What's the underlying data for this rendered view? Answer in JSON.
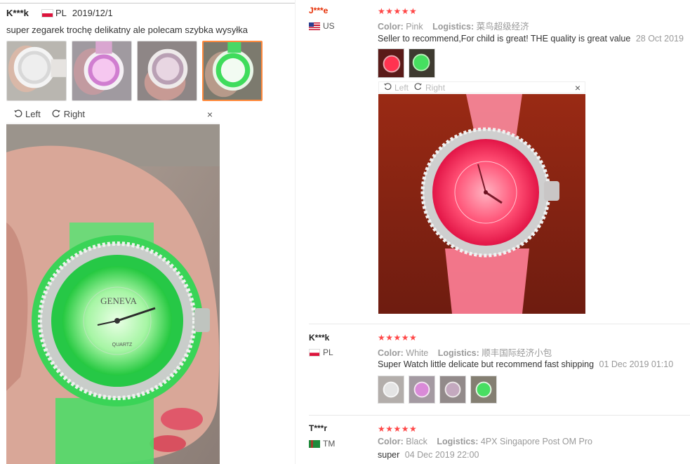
{
  "left_review": {
    "user": "K***k",
    "country": "PL",
    "date": "2019/12/1",
    "text": "super zegarek trochę delikatny ale polecam szybka wysyłka",
    "viewer": {
      "left_label": "Left",
      "right_label": "Right",
      "close": "×"
    },
    "photo_logo": "GENEVA",
    "photo_sub": "QUARTZ"
  },
  "right_reviews": [
    {
      "user": "J***e",
      "country": "US",
      "stars": "★★★★★",
      "color_label": "Color:",
      "color_value": "Pink",
      "logistics_label": "Logistics:",
      "logistics_value": "菜鸟超级经济",
      "text": "Seller to recommend,For child is great! THE quality is great value",
      "date": "28 Oct 2019",
      "viewer": {
        "left_label": "Left",
        "right_label": "Right",
        "close": "×"
      }
    },
    {
      "user": "K***k",
      "country": "PL",
      "stars": "★★★★★",
      "color_label": "Color:",
      "color_value": "White",
      "logistics_label": "Logistics:",
      "logistics_value": "顺丰国际经济小包",
      "text": "Super Watch little delicate but recommend fast shipping",
      "date": "01 Dec 2019 01:10"
    },
    {
      "user": "T***r",
      "country": "TM",
      "stars": "★★★★★",
      "color_label": "Color:",
      "color_value": "Black",
      "logistics_label": "Logistics:",
      "logistics_value": "4PX Singapore Post OM Pro",
      "text": "super",
      "date": "04 Dec 2019 22:00"
    }
  ],
  "colors": {
    "accent_star": "#ff4747",
    "selected_thumb": "#ff8a3d",
    "username_red": "#e62e04",
    "glow_green": "#38e85a",
    "glow_pink": "#ff3f6a"
  },
  "icons": {
    "rotate_left": "rotate-left-icon",
    "rotate_right": "rotate-right-icon",
    "close": "close-icon"
  }
}
